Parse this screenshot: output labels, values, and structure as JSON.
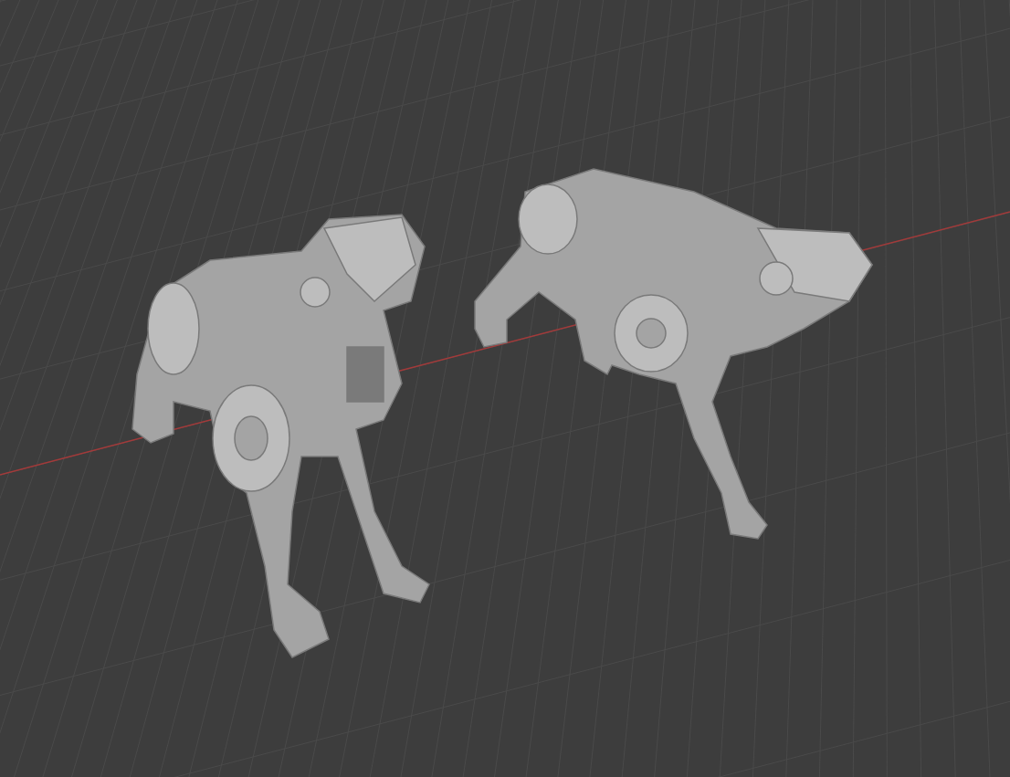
{
  "viewport": {
    "objects": [
      {
        "kind": "robot-dog"
      },
      {
        "kind": "robot-dog"
      }
    ]
  }
}
